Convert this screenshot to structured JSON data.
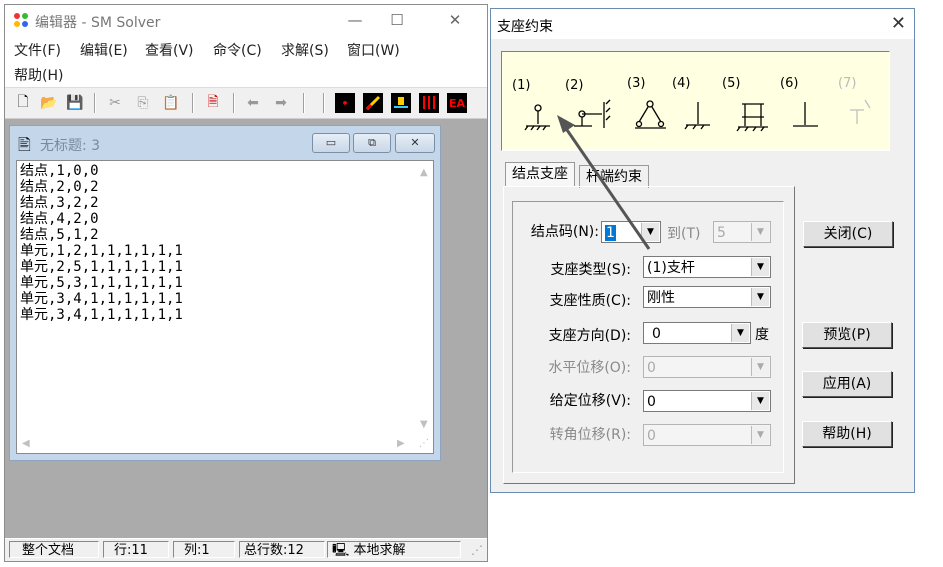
{
  "editor": {
    "title": "编辑器 - SM Solver",
    "window_buttons": [
      "—",
      "☐",
      "✕"
    ],
    "menu": [
      "文件(F)",
      "编辑(E)",
      "查看(V)",
      "命令(C)",
      "求解(S)",
      "窗口(W)",
      "帮助(H)"
    ],
    "toolbar": {
      "red_button_label": "EA"
    },
    "document": {
      "title": "无标题: 3",
      "lines": [
        "结点,1,0,0",
        "结点,2,0,2",
        "结点,3,2,2",
        "结点,4,2,0",
        "结点,5,1,2",
        "单元,1,2,1,1,1,1,1,1",
        "单元,2,5,1,1,1,1,1,1",
        "单元,5,3,1,1,1,1,1,1",
        "单元,3,4,1,1,1,1,1,1",
        "单元,3,4,1,1,1,1,1,1"
      ]
    },
    "status": {
      "scope": "整个文档",
      "row": "行:11",
      "col": "列:1",
      "total": "总行数:12",
      "solve_mode": "本地求解"
    }
  },
  "dialog": {
    "title": "支座约束",
    "close": "✕",
    "support_types": [
      "(1)",
      "(2)",
      "(3)",
      "(4)",
      "(5)",
      "(6)",
      "(7)"
    ],
    "tabs": [
      "结点支座",
      "杆端约束"
    ],
    "fields": {
      "node_code_label": "结点码(N):",
      "node_code_value": "1",
      "to_label": "到(T)",
      "to_value": "5",
      "support_type_label": "支座类型(S):",
      "support_type_value": "(1)支杆",
      "support_nature_label": "支座性质(C):",
      "support_nature_value": "刚性",
      "direction_label": "支座方向(D):",
      "direction_value": "0",
      "direction_unit": "度",
      "horizontal_disp_label": "水平位移(O):",
      "horizontal_disp_value": "0",
      "given_disp_label": "给定位移(V):",
      "given_disp_value": "0",
      "rotation_disp_label": "转角位移(R):",
      "rotation_disp_value": "0"
    },
    "buttons": {
      "close": "关闭(C)",
      "preview": "预览(P)",
      "apply": "应用(A)",
      "help": "帮助(H)"
    }
  }
}
